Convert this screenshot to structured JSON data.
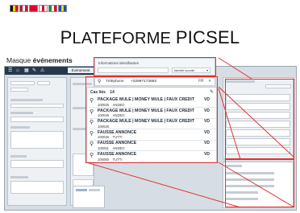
{
  "header": {
    "title_lead": "P",
    "title_rest": "LATEFORME ",
    "title_brand": "PICSEL"
  },
  "section": {
    "prefix": "Masque ",
    "emphasis": "événements"
  },
  "flags": [
    {
      "name": "flag-belgium",
      "colors": [
        "#111111",
        "#ffd400",
        "#e4002b"
      ]
    },
    {
      "name": "flag-latvia-like",
      "colors": [
        "#b21f35",
        "#ffffff",
        "#b21f35"
      ]
    },
    {
      "name": "flag-canton-red",
      "colors": [
        "#e4002b",
        "#e4002b",
        "#e4002b"
      ]
    },
    {
      "name": "flag-canton-redwhite",
      "colors": [
        "#ffffff",
        "#e4002b",
        "#ffffff"
      ]
    },
    {
      "name": "flag-canton-green",
      "colors": [
        "#1f8f3a",
        "#ffffff",
        "#e4002b"
      ]
    },
    {
      "name": "flag-canton-blueyellow",
      "colors": [
        "#1d4fb8",
        "#ffd400",
        "#1d4fb8"
      ]
    }
  ],
  "toolbar": {
    "event_button": "Événement"
  },
  "ident": {
    "label": "Informations identifiantes",
    "dropdown": "Identité sourde",
    "phone_label": "Téléphone",
    "phone_value": "+32997172692",
    "phone_flag": "FR"
  },
  "cases": {
    "header": "Cas liés",
    "count": "14",
    "items": [
      {
        "title": "PACKAGE MULE | MONEY MULE | FAUX CREDIT",
        "code": "100025",
        "code2": "ANDEO",
        "status": "VD"
      },
      {
        "title": "PACKAGE MULE | MONEY MULE | FAUX CREDIT",
        "code": "100048",
        "code2": "ANDEO",
        "status": "VD"
      },
      {
        "title": "PACKAGE MULE | MONEY MULE | FAUX CREDIT",
        "code": "100028",
        "code2": "",
        "status": "VD"
      },
      {
        "title": "FAUSSE ANNONCE",
        "code": "100049",
        "code2": "TUTTI",
        "status": "VD"
      },
      {
        "title": "FAUSSE ANNONCE",
        "code": "100051",
        "code2": "ANDEO",
        "status": "VD"
      },
      {
        "title": "FAUSSE ANNONCE",
        "code": "100050",
        "code2": "TUTTI",
        "status": "VD"
      }
    ]
  },
  "colors": {
    "accent_red": "#e03131",
    "toolbar_navy": "#27384c"
  }
}
